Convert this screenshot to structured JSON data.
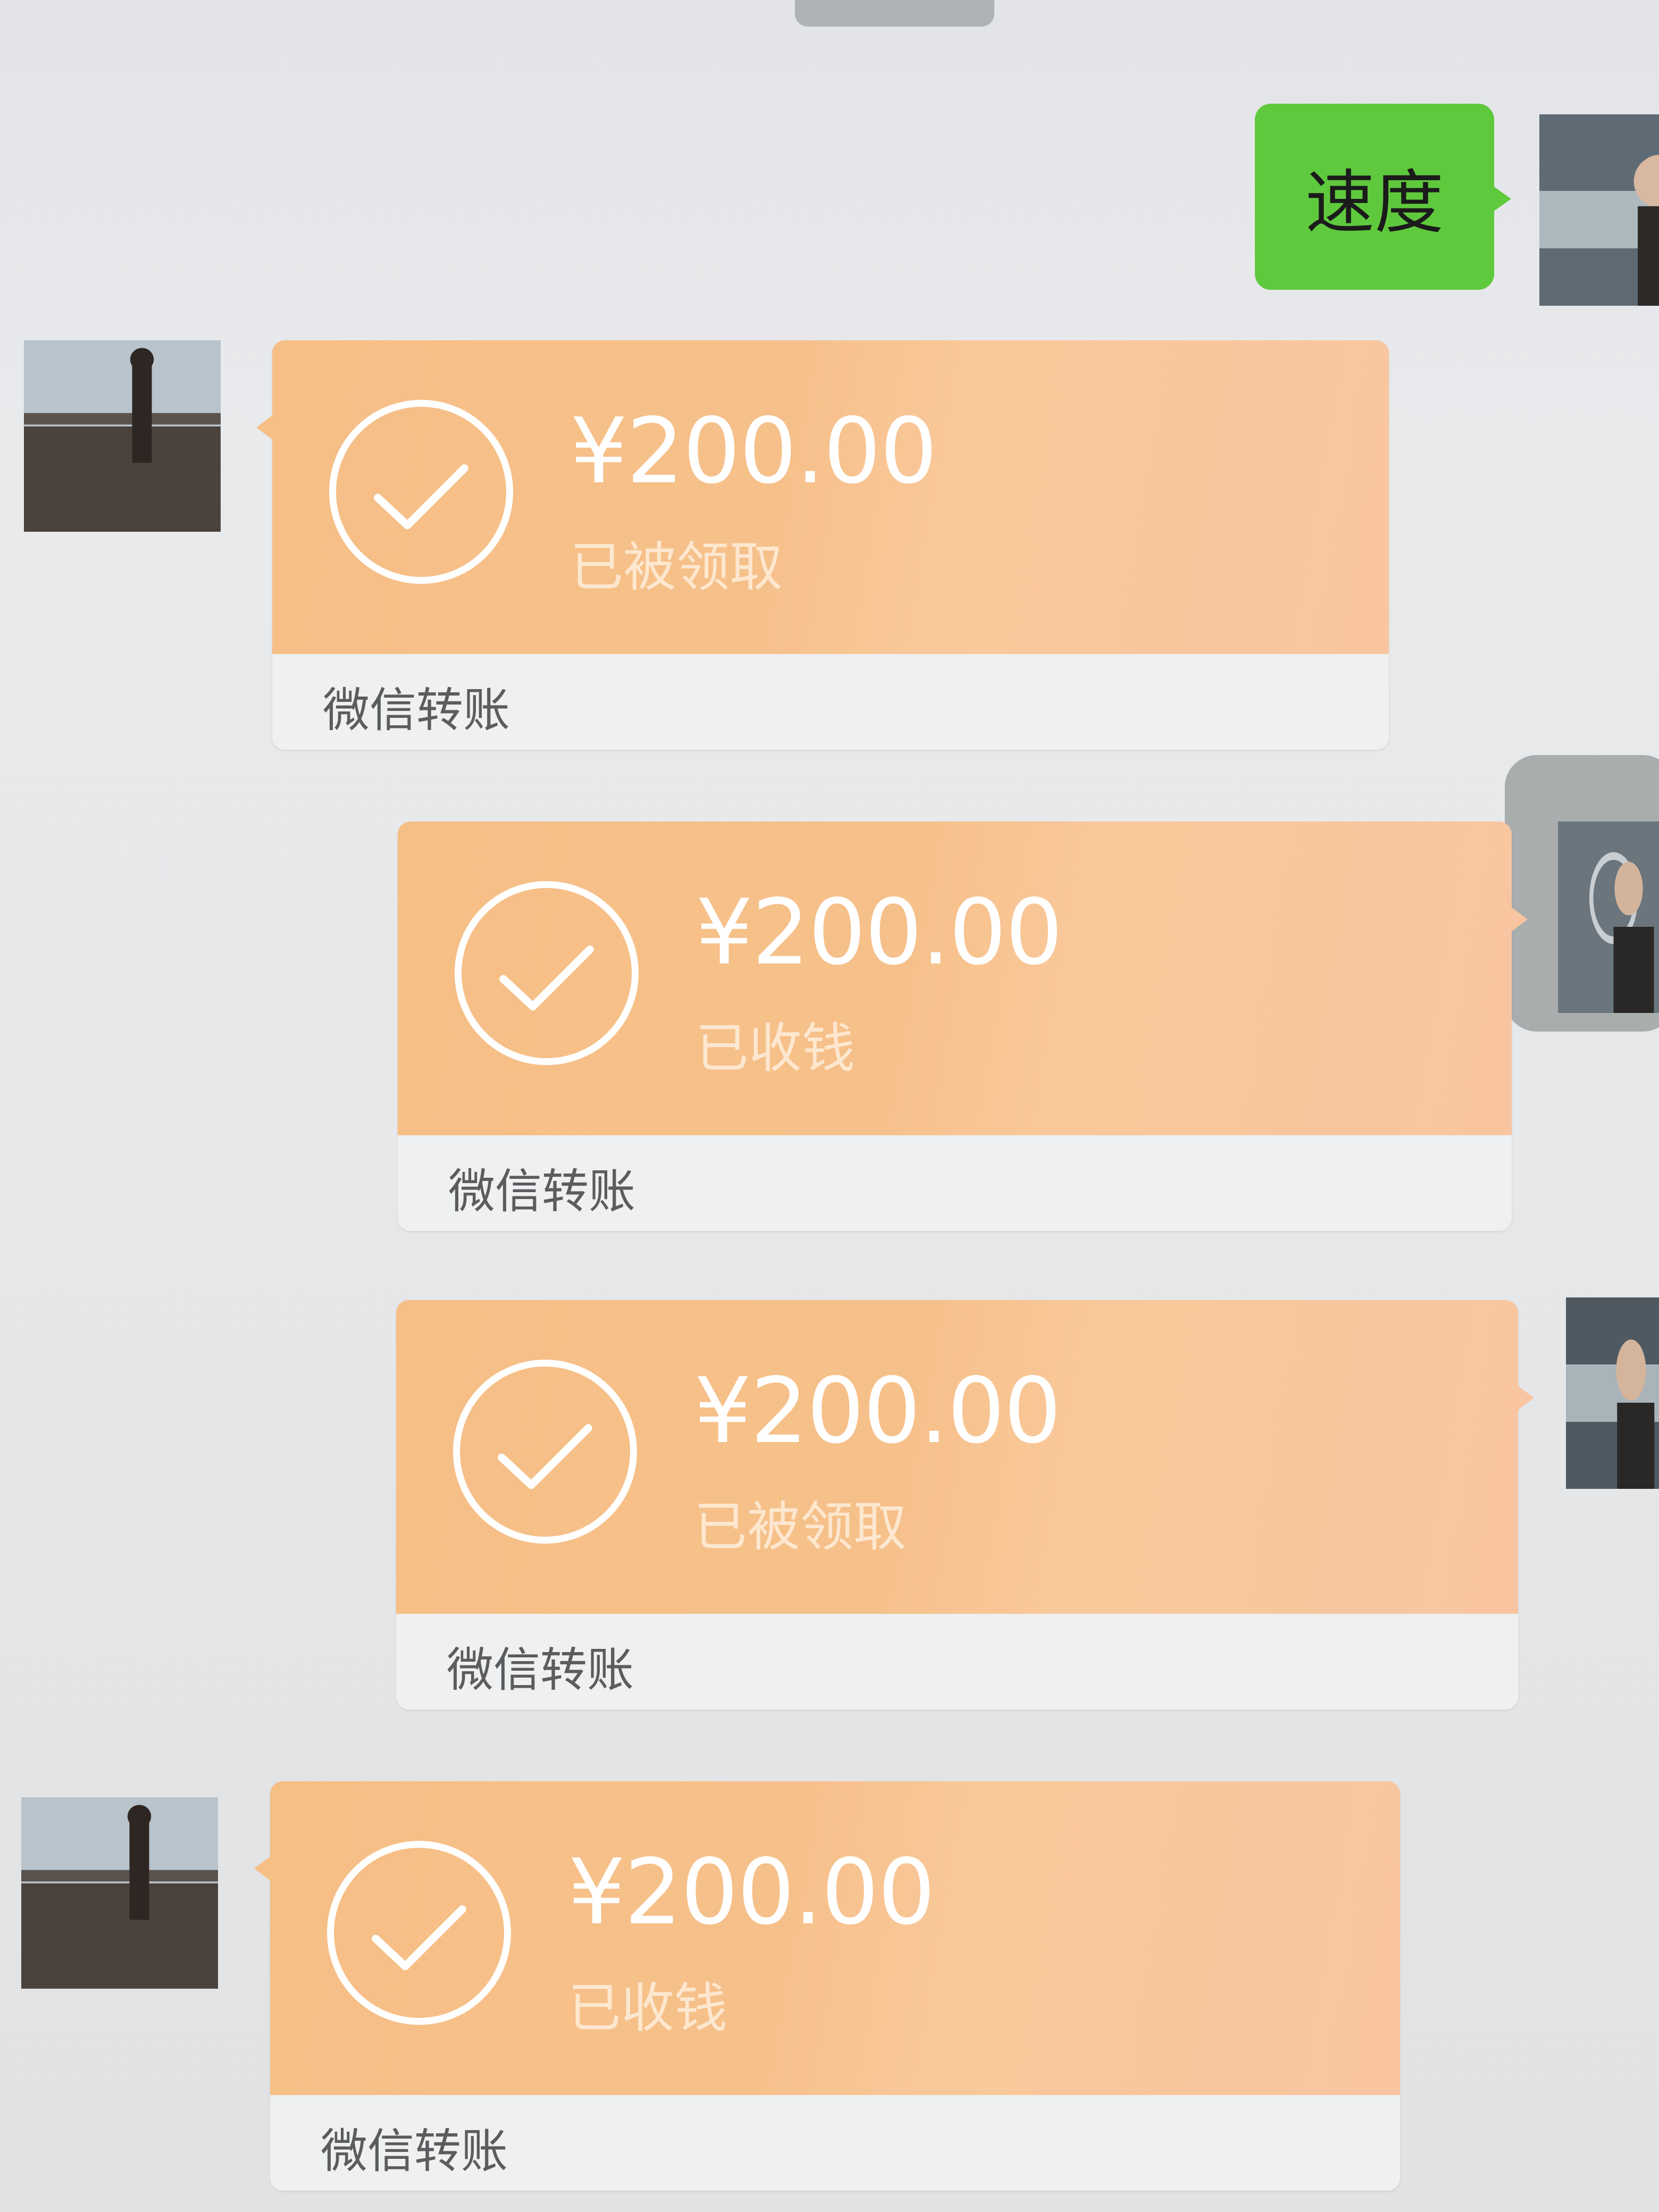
{
  "messages": [
    {
      "type": "text",
      "side": "right",
      "text": "速度"
    },
    {
      "type": "transfer",
      "side": "left",
      "amount": "¥200.00",
      "status": "已被领取",
      "label": "微信转账"
    },
    {
      "type": "transfer",
      "side": "right",
      "amount": "¥200.00",
      "status": "已收钱",
      "label": "微信转账"
    },
    {
      "type": "transfer",
      "side": "right",
      "amount": "¥200.00",
      "status": "已被领取",
      "label": "微信转账"
    },
    {
      "type": "transfer",
      "side": "left",
      "amount": "¥200.00",
      "status": "已收钱",
      "label": "微信转账"
    }
  ],
  "colors": {
    "background": "#e6e8ea",
    "text_bubble": "#5fc93d",
    "transfer_top": "#f6bf86",
    "transfer_bottom": "#eef0f1",
    "amount_text": "#ffffff"
  },
  "icons": {
    "transfer_status": "check-circle-icon"
  }
}
